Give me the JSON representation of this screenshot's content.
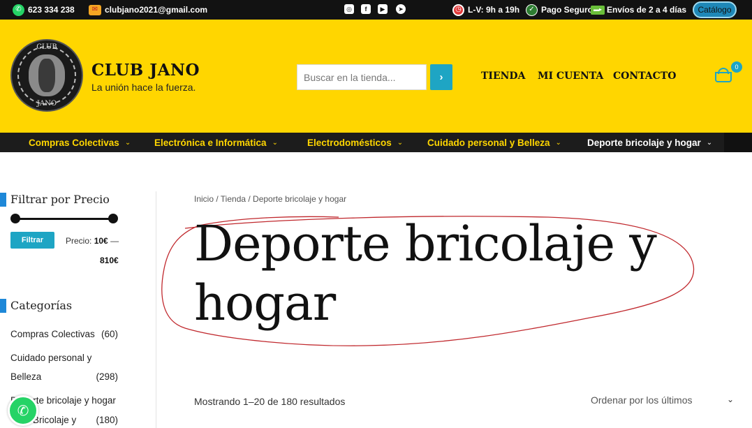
{
  "topbar": {
    "phone": "623 334 238",
    "email": "clubjano2021@gmail.com",
    "hours": "L-V: 9h a 19h",
    "payment": "Pago Seguro",
    "shipping": "Envíos de 2 a 4 días",
    "catalog_label": "Catálogo",
    "social_icons": [
      "instagram-icon",
      "facebook-icon",
      "youtube-icon",
      "telegram-icon"
    ]
  },
  "header": {
    "logo_text_top": "CLUB",
    "logo_text_bottom": "JANO",
    "site_title": "CLUB JANO",
    "tagline": "La unión hace la fuerza.",
    "search_placeholder": "Buscar en la tienda...",
    "nav": [
      "TIENDA",
      "MI CUENTA",
      "CONTACTO"
    ],
    "cart_count": "0"
  },
  "category_nav": [
    {
      "label": "Compras Colectivas",
      "active": false
    },
    {
      "label": "Electrónica e Informática",
      "active": false
    },
    {
      "label": "Electrodomésticos",
      "active": false
    },
    {
      "label": "Cuidado personal y Belleza",
      "active": false
    },
    {
      "label": "Deporte bricolaje y hogar",
      "active": true
    }
  ],
  "sidebar": {
    "price_filter_title": "Filtrar por Precio",
    "filter_button": "Filtrar",
    "price_prefix": "Precio:",
    "price_min": "10€",
    "price_sep": "—",
    "price_max": "810€",
    "categories_title": "Categorías",
    "categories": [
      {
        "name": "Compras Colectivas",
        "count": "(60)"
      },
      {
        "name": "Cuidado personal y",
        "count": ""
      },
      {
        "name": "Belleza",
        "count": "(298)"
      },
      {
        "name": "Deporte bricolaje y hogar",
        "count": ""
      },
      {
        "name": "Bricolaje y",
        "count": "(180)"
      }
    ]
  },
  "main": {
    "breadcrumb": "Inicio / Tienda / Deporte bricolaje y hogar",
    "title": "Deporte bricolaje y hogar",
    "results": "Mostrando 1–20 de 180 resultados",
    "sort_label": "Ordenar por los últimos"
  },
  "colors": {
    "header_yellow": "#ffd600",
    "accent_cyan": "#1ea5c4",
    "topbar_black": "#121212",
    "annotation_red": "#c0282d"
  }
}
